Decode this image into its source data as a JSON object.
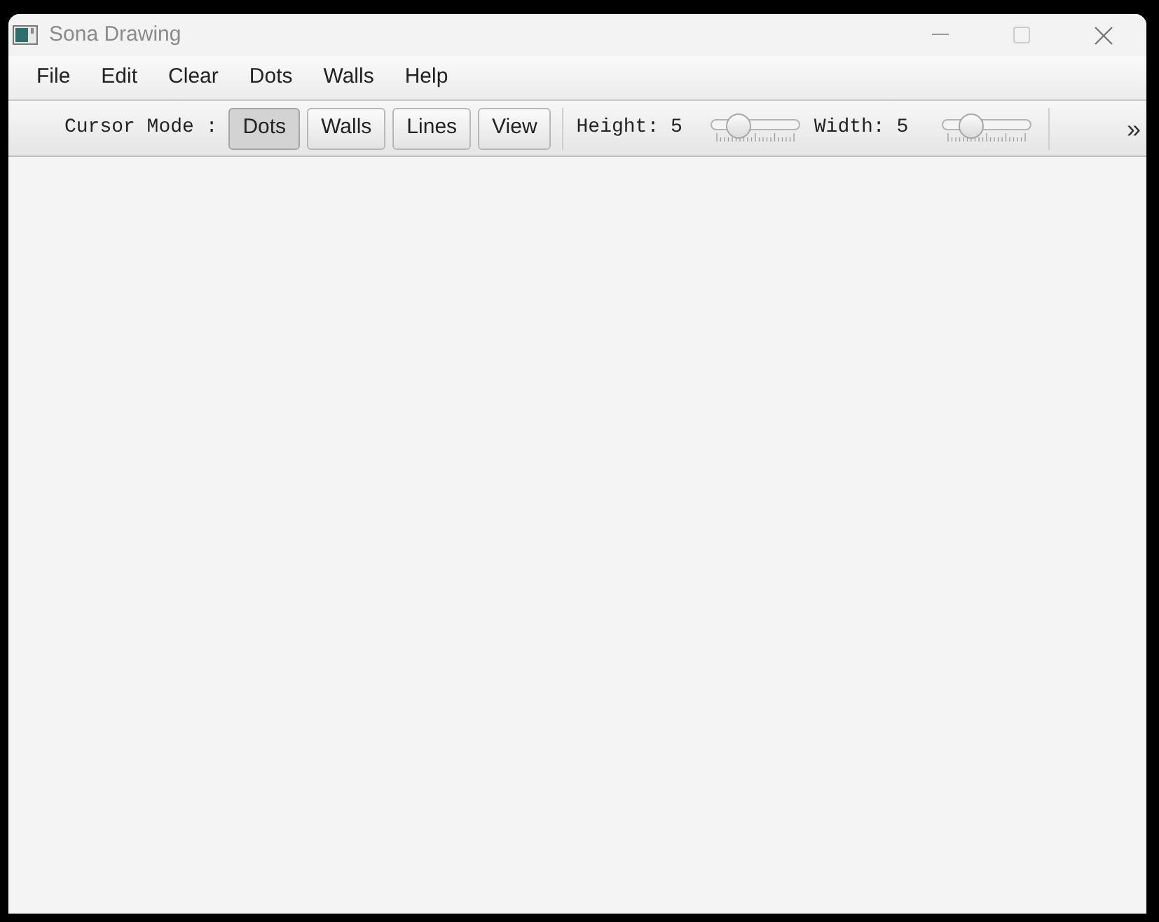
{
  "window": {
    "title": "Sona Drawing"
  },
  "menu": [
    "File",
    "Edit",
    "Clear",
    "Dots",
    "Walls",
    "Help"
  ],
  "toolbar": {
    "cursor_mode_label": "Cursor Mode :",
    "modes": [
      {
        "label": "Dots",
        "selected": true
      },
      {
        "label": "Walls",
        "selected": false
      },
      {
        "label": "Lines",
        "selected": false
      },
      {
        "label": "View",
        "selected": false
      }
    ],
    "sliders": [
      {
        "label": "Height: 5",
        "level": 0.25
      },
      {
        "label": "Width: 5",
        "level": 0.25
      }
    ],
    "overflow": "»"
  }
}
